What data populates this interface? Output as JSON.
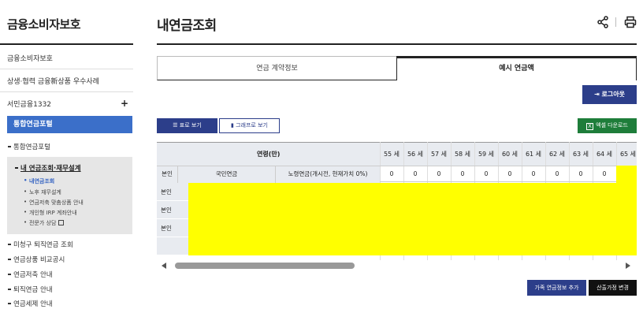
{
  "sidebar": {
    "title": "금융소비자보호",
    "links": [
      "금융소비자보호",
      "상생·협력 금융新상품 우수사례",
      "서민금융1332"
    ],
    "portal_label": "통합연금포털",
    "portal_item": "통합연금포털",
    "active_item": "내 연금조회·재무설계",
    "sub_items": [
      "내연금조회",
      "노후 재무설계",
      "연금저축 맞춤상품 안내",
      "개인형 IRP 계좌안내",
      "전문가 상담"
    ],
    "items_after": [
      "미청구 퇴직연금 조회",
      "연금상품 비교공시",
      "연금저축 안내",
      "퇴직연금 안내",
      "연금세제 안내"
    ]
  },
  "header": {
    "title": "내연금조회"
  },
  "tabs": [
    "연금 계약정보",
    "예시 연금액"
  ],
  "buttons": {
    "logout": "로그아웃",
    "table_view": "표로 보기",
    "graph_view": "그래프로 보기",
    "excel": "엑셀 다운로드",
    "add_family": "가족 연금정보 추가",
    "change_assumption": "산출가정 변경"
  },
  "table": {
    "age_header": "연령(만)",
    "ages": [
      "55 세",
      "56 세",
      "57 세",
      "58 세",
      "59 세",
      "60 세",
      "61 세",
      "62 세",
      "63 세",
      "64 세",
      "65 세"
    ],
    "row_self": "본인",
    "national_pension": "국민연금",
    "old_age_pension": "노령연금(개시전, 현재가치 0%)",
    "values": [
      "0",
      "0",
      "0",
      "0",
      "0",
      "0",
      "0",
      "0",
      "0",
      "0"
    ],
    "row_labels": [
      "본인",
      "본인",
      "본인"
    ]
  },
  "colors": {
    "primary": "#2c3e8a",
    "portal": "#3b6fc9",
    "excel": "#1e7d3a",
    "highlight": "#ffff00"
  }
}
